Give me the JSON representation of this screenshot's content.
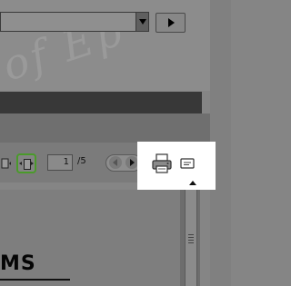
{
  "background": {
    "watermark_text": "of Ep"
  },
  "toolbar": {
    "current_page": "1",
    "total_pages": "/5"
  },
  "document": {
    "heading_fragment": "MS"
  },
  "colors": {
    "fit_button_outline": "#4a9a2a",
    "highlight_box": "#ffffff",
    "dark_bar": "#383838"
  },
  "icons": {
    "print": "printer-icon",
    "comment": "comment-icon",
    "fit_width": "fit-width-icon",
    "prev_page": "arrow-left-icon",
    "next_page": "arrow-right-icon",
    "dropdown": "chevron-down-icon",
    "go": "play-icon",
    "scroll_up": "arrow-up-icon"
  }
}
